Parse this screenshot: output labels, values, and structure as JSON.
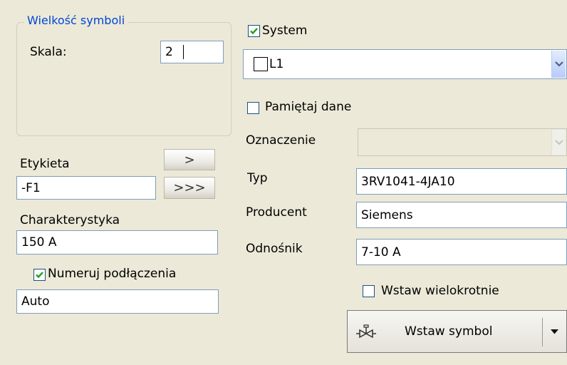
{
  "symbol_size": {
    "title": "Wielkość symboli",
    "scale_label": "Skala:",
    "scale_value": "2"
  },
  "label_section": {
    "etykieta_label": "Etykieta",
    "etykieta_value": "-F1",
    "next_button": ">",
    "all_button": ">>>",
    "charakterystyka_label": "Charakterystyka",
    "charakterystyka_value": "150 A",
    "numeruj_label": "Numeruj podłączenia",
    "numeruj_checked": true,
    "numeruj_value": "Auto"
  },
  "system": {
    "label": "System",
    "checked": true,
    "selected": "L1"
  },
  "pamietaj": {
    "label": "Pamiętaj dane",
    "checked": false
  },
  "fields": {
    "oznaczenie_label": "Oznaczenie",
    "oznaczenie_value": "",
    "typ_label": "Typ",
    "typ_value": "3RV1041-4JA10",
    "producent_label": "Producent",
    "producent_value": "Siemens",
    "odnosnik_label": "Odnośnik",
    "odnosnik_value": "7-10 A"
  },
  "wstaw_wielokrotnie": {
    "label": "Wstaw wielokrotnie",
    "checked": false
  },
  "insert_button": {
    "label": "Wstaw symbol",
    "icon": "valve-symbol-icon"
  },
  "colors": {
    "background": "#ECE9D8",
    "group_title": "#0046D5",
    "field_border": "#7F9DB9",
    "check_mark": "#21A121"
  }
}
